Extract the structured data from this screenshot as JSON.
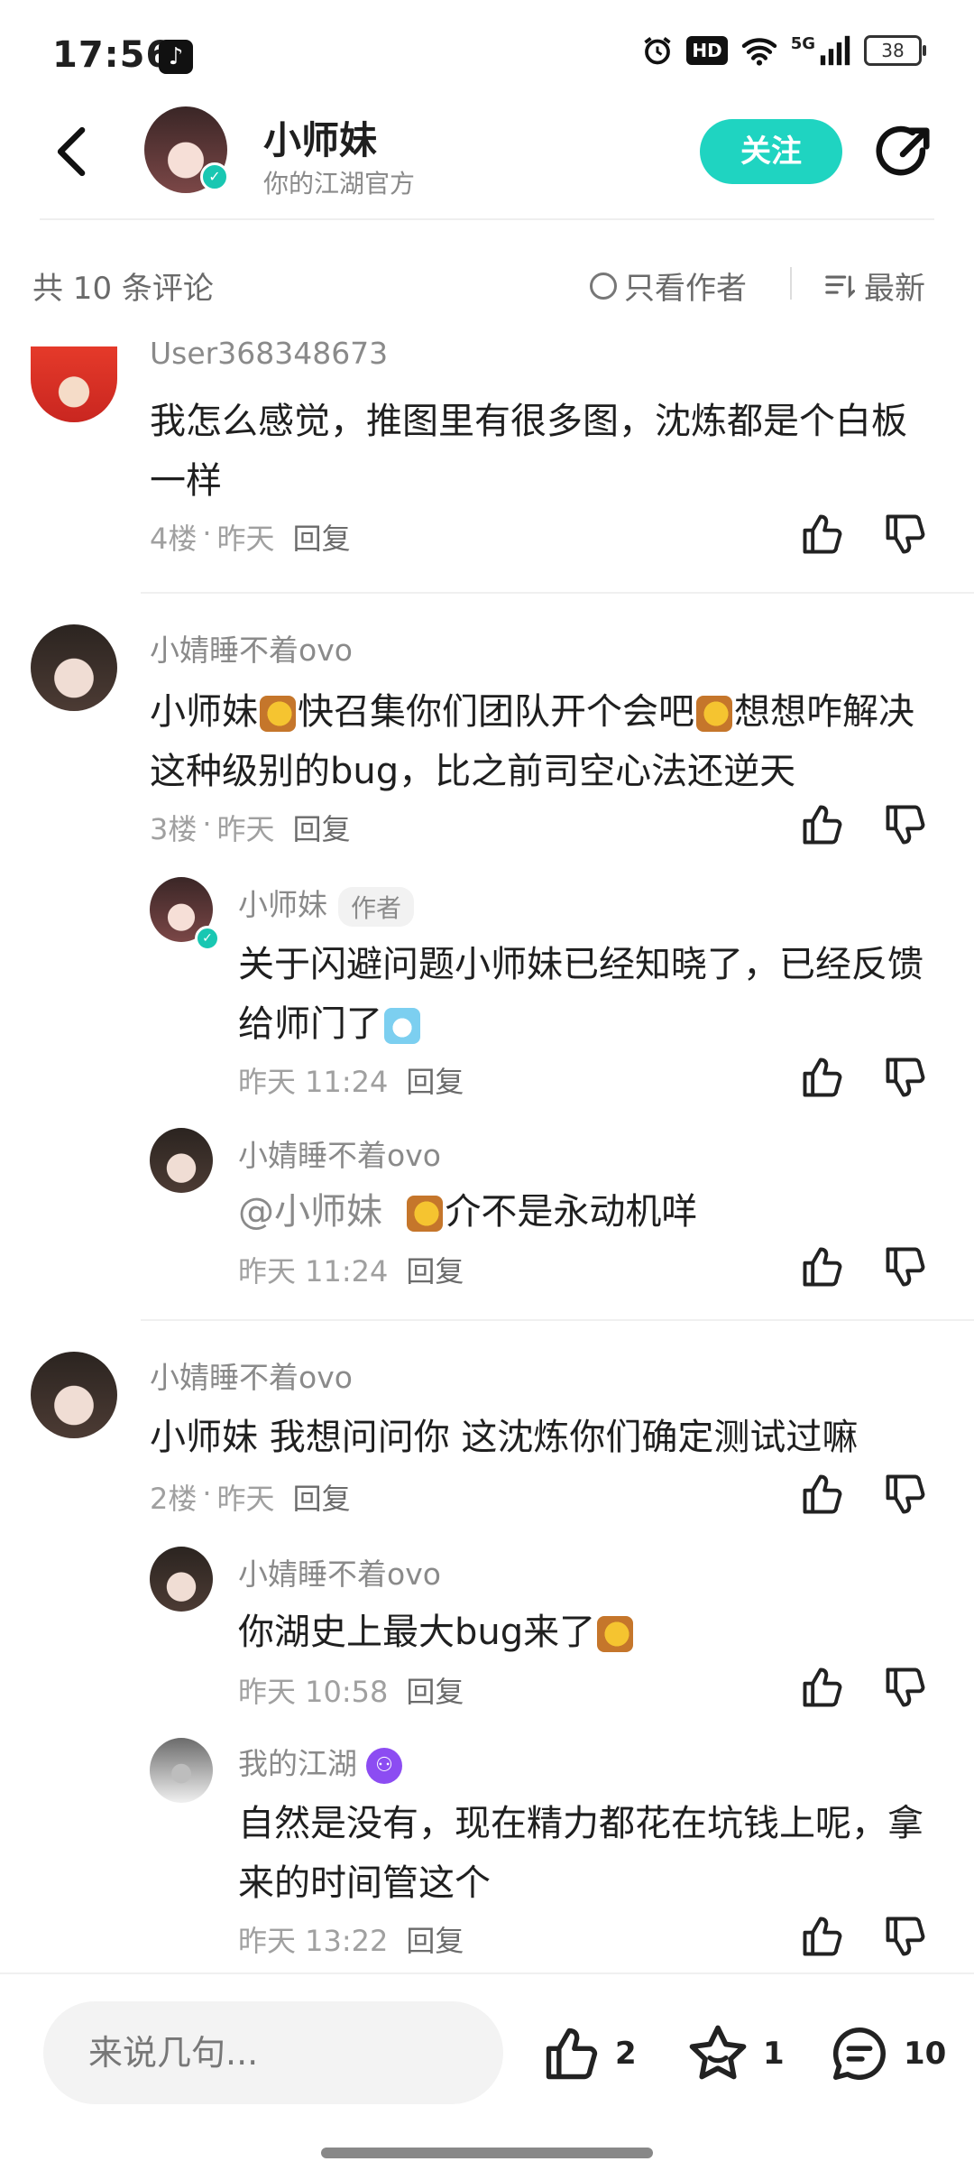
{
  "status_bar": {
    "time": "17:56",
    "hd": "HD",
    "network": "5G",
    "battery": "38"
  },
  "header": {
    "name": "小师妹",
    "subtitle": "你的江湖官方",
    "follow_label": "关注"
  },
  "comments_bar": {
    "count_label": "共 10 条评论",
    "author_only_label": "只看作者",
    "sort_label": "最新"
  },
  "comments": [
    {
      "user": "User368348673",
      "text": "我怎么感觉，推图里有很多图，沈炼都是个白板一样",
      "floor": "4楼",
      "time": "昨天",
      "reply": "回复"
    },
    {
      "user": "小婧睡不着ovo",
      "text_parts": [
        "小师妹",
        "快召集你们团队开个会吧",
        "想想咋解决这种级别的bug，比之前司空心法还逆天"
      ],
      "floor": "3楼",
      "time": "昨天",
      "reply": "回复",
      "replies": [
        {
          "user": "小师妹",
          "tag": "作者",
          "text": "关于闪避问题小师妹已经知晓了，已经反馈给师门了",
          "time": "昨天 11:24",
          "reply": "回复"
        },
        {
          "user": "小婧睡不着ovo",
          "mention": "@小师妹",
          "text": "介不是永动机咩",
          "time": "昨天 11:24",
          "reply": "回复"
        }
      ]
    },
    {
      "user": "小婧睡不着ovo",
      "text": "小师妹 我想问问你 这沈炼你们确定测试过嘛",
      "floor": "2楼",
      "time": "昨天",
      "reply": "回复",
      "replies": [
        {
          "user": "小婧睡不着ovo",
          "text": "你湖史上最大bug来了",
          "time": "昨天 10:58",
          "reply": "回复"
        },
        {
          "user": "我的江湖",
          "text": "自然是没有，现在精力都花在坑钱上呢，拿来的时间管这个",
          "time": "昨天 13:22",
          "reply": "回复"
        }
      ]
    }
  ],
  "bottom_bar": {
    "input_placeholder": "来说几句...",
    "likes": "2",
    "favorites": "1",
    "comments": "10"
  },
  "colors": {
    "accent": "#1fd4c1",
    "text": "#1f1f1f",
    "muted": "#8a8a8a"
  }
}
